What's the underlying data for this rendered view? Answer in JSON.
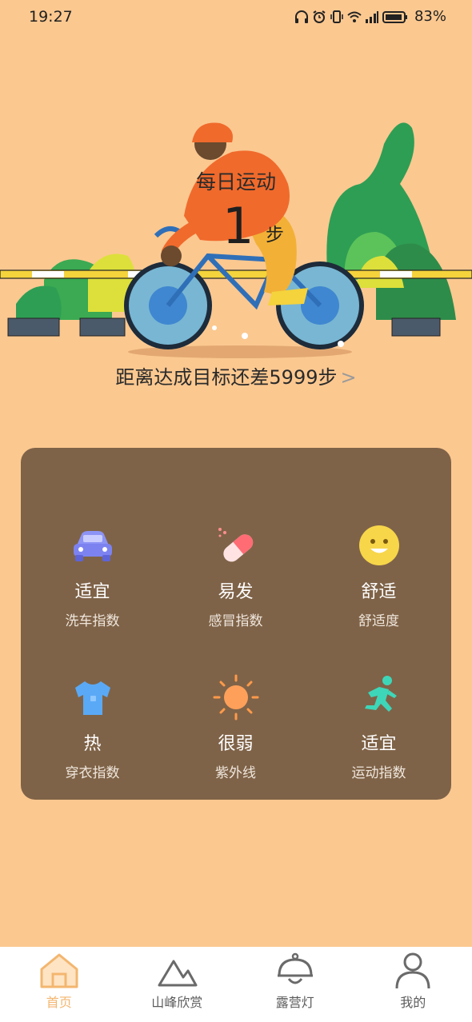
{
  "status_bar": {
    "time": "19:27",
    "battery": "83%"
  },
  "hero": {
    "title": "每日运动",
    "steps": "1",
    "steps_unit": "步",
    "remaining": "距离达成目标还差5999步"
  },
  "indices": [
    {
      "value": "适宜",
      "label": "洗车指数",
      "icon": "car-icon"
    },
    {
      "value": "易发",
      "label": "感冒指数",
      "icon": "pill-icon"
    },
    {
      "value": "舒适",
      "label": "舒适度",
      "icon": "smiley-icon"
    },
    {
      "value": "热",
      "label": "穿衣指数",
      "icon": "shirt-icon"
    },
    {
      "value": "很弱",
      "label": "紫外线",
      "icon": "sun-icon"
    },
    {
      "value": "适宜",
      "label": "运动指数",
      "icon": "runner-icon"
    }
  ],
  "nav": [
    {
      "label": "首页",
      "icon": "home-icon",
      "active": true
    },
    {
      "label": "山峰欣赏",
      "icon": "mountain-icon",
      "active": false
    },
    {
      "label": "露营灯",
      "icon": "lamp-icon",
      "active": false
    },
    {
      "label": "我的",
      "icon": "user-icon",
      "active": false
    }
  ],
  "colors": {
    "background": "#FBC890",
    "card": "#7F6348",
    "active_nav": "#F3B66F"
  }
}
